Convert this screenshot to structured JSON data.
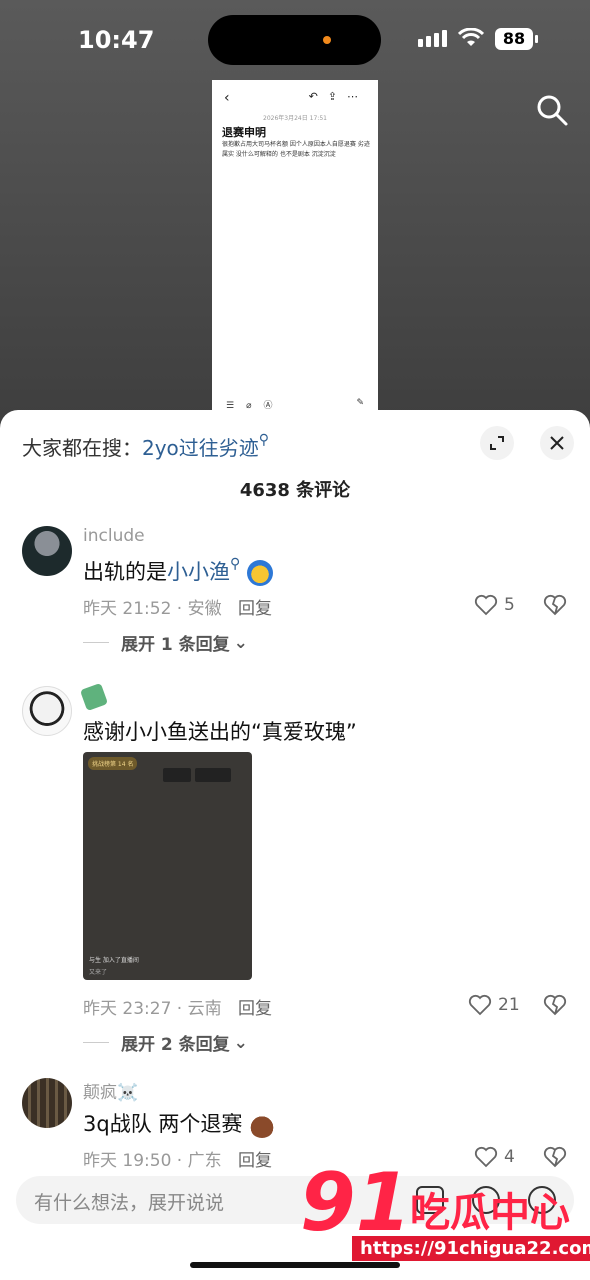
{
  "status": {
    "time": "10:47",
    "battery": "88"
  },
  "preview": {
    "date": "2026年3月24日 17:51",
    "title": "退赛申明",
    "body": "很抱歉占用大司马杯名额 因个人原因本人自愿退赛 劣迹属实 没什么可解释的 也不是剧本 沉淀沉淀"
  },
  "sheet": {
    "search_prefix": "大家都在搜：",
    "search_keyword": "2yo过往劣迹",
    "comment_count": "4638 条评论"
  },
  "comments": [
    {
      "user": "include",
      "text_prefix": "出轨的是",
      "text_link": "小小渔",
      "meta": "昨天 21:52 · 安徽",
      "reply": "回复",
      "likes": "5",
      "expand": "展开 1 条回复"
    },
    {
      "user": "",
      "text": "感谢小小鱼送出的“真爱玫瑰”",
      "image_tag": "挑战榜第 14 名",
      "image_foot": "与生 加入了直播间",
      "image_foot2": "又来了",
      "meta": "昨天 23:27 · 云南",
      "reply": "回复",
      "likes": "21",
      "expand": "展开 2 条回复"
    },
    {
      "user": "颠疯☠️",
      "text": "3q战队 两个退赛",
      "meta": "昨天 19:50 · 广东",
      "reply": "回复",
      "likes": "4"
    }
  ],
  "input": {
    "placeholder": "有什么想法，展开说说"
  },
  "watermark": {
    "num": "91",
    "text": "吃瓜中心",
    "url": "https://91chigua22.com"
  },
  "icons": [
    "search-icon",
    "expand-icon",
    "close-icon",
    "heart-icon",
    "dislike-icon",
    "chevron-down-icon",
    "at-icon",
    "emoji-icon"
  ]
}
